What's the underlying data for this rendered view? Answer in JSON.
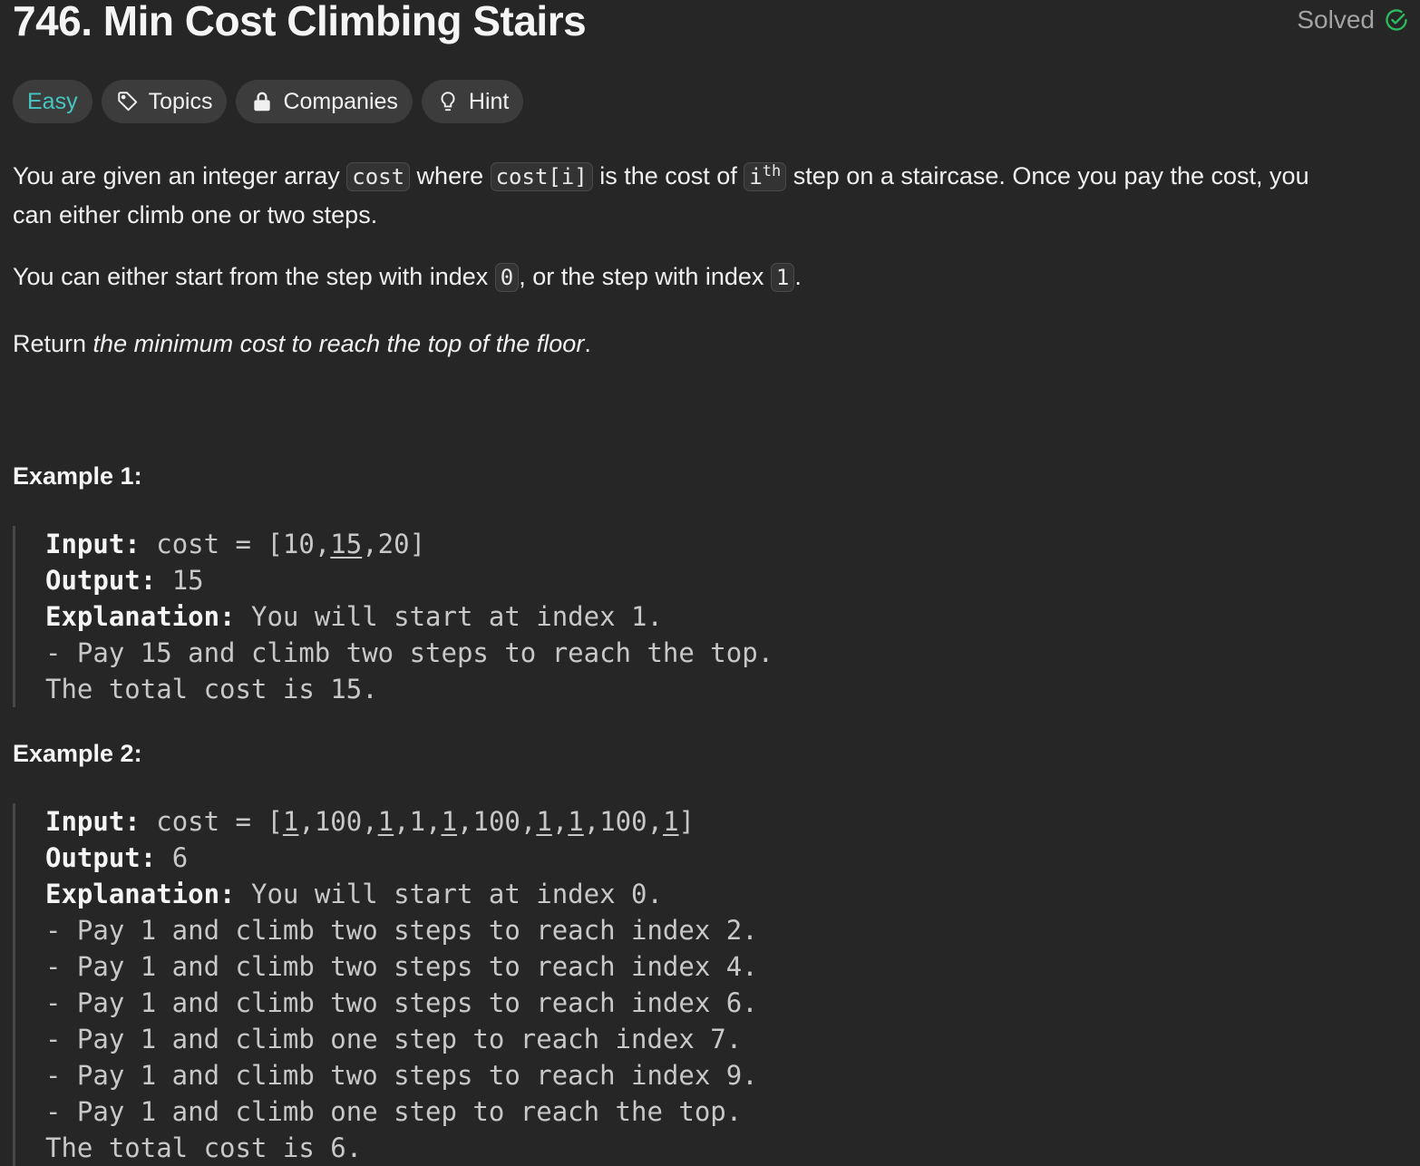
{
  "problem": {
    "title": "746. Min Cost Climbing Stairs",
    "status": "Solved",
    "difficulty": "Easy",
    "tags": {
      "topics": "Topics",
      "companies": "Companies",
      "hint": "Hint"
    }
  },
  "description": {
    "p1_a": "You are given an integer array ",
    "code_cost": "cost",
    "p1_b": " where ",
    "code_cost_i": "cost[i]",
    "p1_c": " is the cost of ",
    "code_i": "i",
    "sup_th": "th",
    "p1_d": " step on a staircase. Once you pay the cost, you",
    "p1_line2": "can either climb one or two steps.",
    "p2_a": "You can either start from the step with index ",
    "code_0": "0",
    "p2_b": ", or the step with index ",
    "code_1": "1",
    "p2_c": ".",
    "p3_a": "Return ",
    "p3_em": "the minimum cost to reach the top of the floor",
    "p3_c": "."
  },
  "labels": {
    "input": "Input:",
    "output": "Output:",
    "explanation": "Explanation:"
  },
  "example1": {
    "heading": "Example 1:",
    "input_prefix": "cost = [10,",
    "input_u": "15",
    "input_suffix": ",20]",
    "output": "15",
    "explanation": "You will start at index 1.",
    "lines": [
      "- Pay 15 and climb two steps to reach the top.",
      "The total cost is 15."
    ]
  },
  "example2": {
    "heading": "Example 2:",
    "input_segments": [
      {
        "t": "cost = [",
        "u": false
      },
      {
        "t": "1",
        "u": true
      },
      {
        "t": ",100,",
        "u": false
      },
      {
        "t": "1",
        "u": true
      },
      {
        "t": ",1,",
        "u": false
      },
      {
        "t": "1",
        "u": true
      },
      {
        "t": ",100,",
        "u": false
      },
      {
        "t": "1",
        "u": true
      },
      {
        "t": ",",
        "u": false
      },
      {
        "t": "1",
        "u": true
      },
      {
        "t": ",100,",
        "u": false
      },
      {
        "t": "1",
        "u": true
      },
      {
        "t": "]",
        "u": false
      }
    ],
    "output": "6",
    "explanation": "You will start at index 0.",
    "lines": [
      "- Pay 1 and climb two steps to reach index 2.",
      "- Pay 1 and climb two steps to reach index 4.",
      "- Pay 1 and climb two steps to reach index 6.",
      "- Pay 1 and climb one step to reach index 7.",
      "- Pay 1 and climb two steps to reach index 9.",
      "- Pay 1 and climb one step to reach the top.",
      "The total cost is 6."
    ]
  }
}
